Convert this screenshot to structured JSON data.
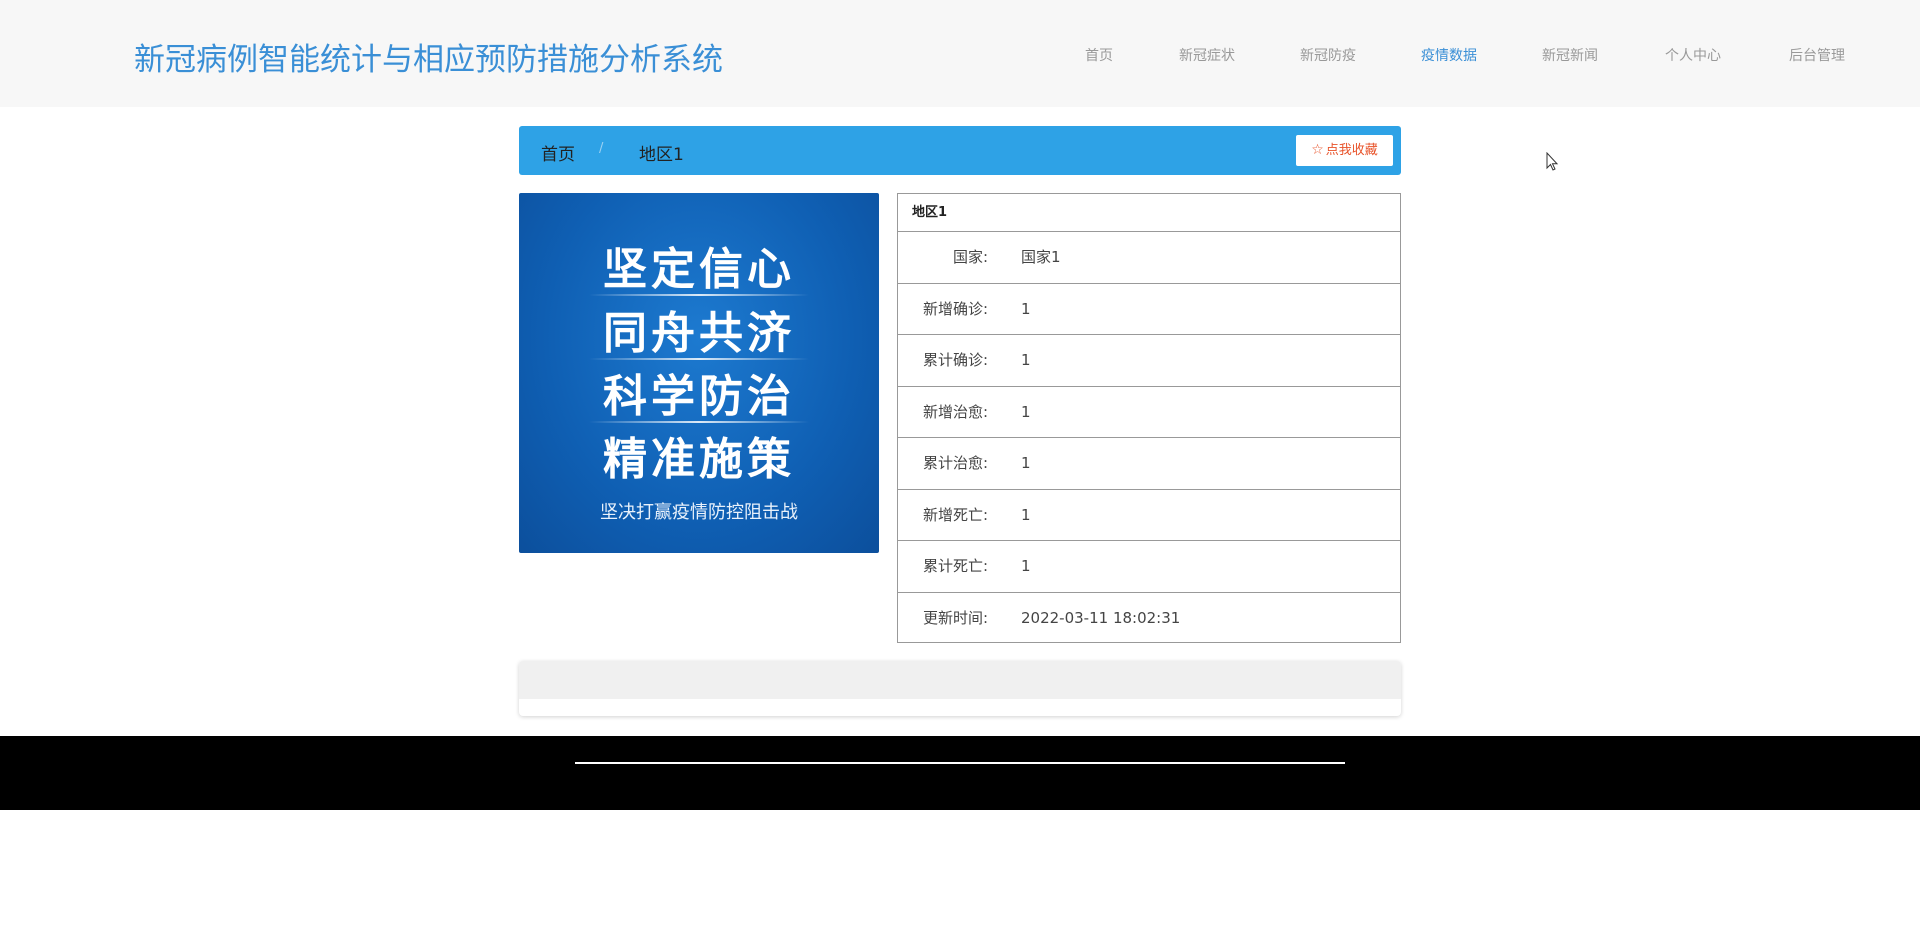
{
  "site": {
    "title": "新冠病例智能统计与相应预防措施分析系统"
  },
  "nav": [
    {
      "label": "首页",
      "active": false
    },
    {
      "label": "新冠症状",
      "active": false
    },
    {
      "label": "新冠防疫",
      "active": false
    },
    {
      "label": "疫情数据",
      "active": true
    },
    {
      "label": "新冠新闻",
      "active": false
    },
    {
      "label": "个人中心",
      "active": false
    },
    {
      "label": "后台管理",
      "active": false
    }
  ],
  "breadcrumb": {
    "home": "首页",
    "separator": "/",
    "current": "地区1"
  },
  "favorite_button": {
    "icon": "star-outline-icon",
    "label": "点我收藏"
  },
  "poster": {
    "lines": [
      "坚定信心",
      "同舟共济",
      "科学防治",
      "精准施策"
    ],
    "subtitle": "坚决打赢疫情防控阻击战"
  },
  "detail": {
    "title": "地区1",
    "rows": [
      {
        "label": "国家:",
        "value": "国家1"
      },
      {
        "label": "新增确诊:",
        "value": "1"
      },
      {
        "label": "累计确诊:",
        "value": "1"
      },
      {
        "label": "新增治愈:",
        "value": "1"
      },
      {
        "label": "累计治愈:",
        "value": "1"
      },
      {
        "label": "新增死亡:",
        "value": "1"
      },
      {
        "label": "累计死亡:",
        "value": "1"
      },
      {
        "label": "更新时间:",
        "value": "2022-03-11 18:02:31"
      }
    ]
  },
  "colors": {
    "title": "#3a8fd6",
    "breadcrumb_bg": "#2ea2e6",
    "favorite_text": "#e8532a",
    "footer_bg": "#000000"
  }
}
